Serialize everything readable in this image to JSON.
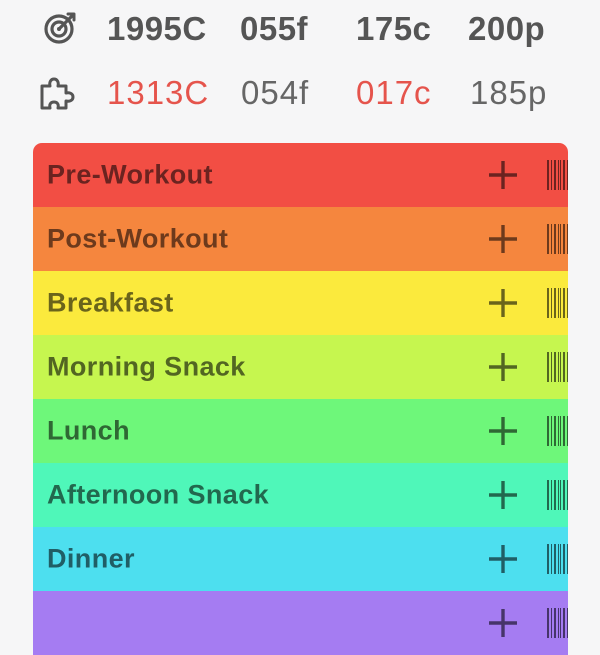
{
  "goals": {
    "icon": "target-icon",
    "calories": "1995C",
    "fat": "055f",
    "carbs": "175c",
    "protein": "200p"
  },
  "remaining": {
    "icon": "puzzle-icon",
    "calories": "1313C",
    "fat": "054f",
    "carbs": "017c",
    "protein": "185p",
    "over_color": "#e5544c"
  },
  "meals": [
    {
      "label": "Pre-Workout",
      "bg": "#f24e44",
      "fg": "#6b2320"
    },
    {
      "label": "Post-Workout",
      "bg": "#f5863e",
      "fg": "#6d3a1c"
    },
    {
      "label": "Breakfast",
      "bg": "#fbea3d",
      "fg": "#6a641b"
    },
    {
      "label": "Morning Snack",
      "bg": "#c6f64f",
      "fg": "#526622"
    },
    {
      "label": "Lunch",
      "bg": "#6ef77a",
      "fg": "#2f6834"
    },
    {
      "label": "Afternoon Snack",
      "bg": "#4ff7b9",
      "fg": "#22684e"
    },
    {
      "label": "Dinner",
      "bg": "#4ddfef",
      "fg": "#205e66"
    },
    {
      "label": "",
      "bg": "#a57cf2",
      "fg": "#46346a"
    }
  ],
  "icons": {
    "add": "plus-icon",
    "scan": "barcode-icon"
  }
}
